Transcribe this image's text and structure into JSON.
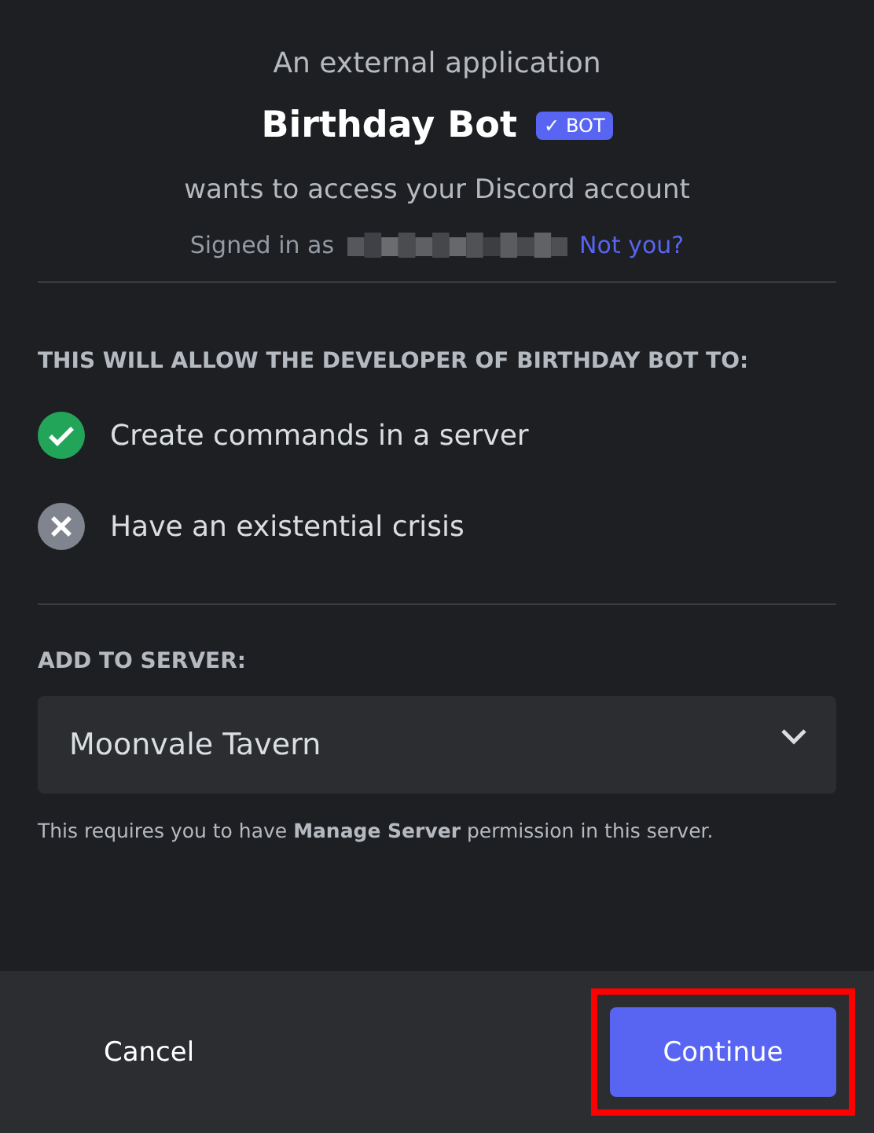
{
  "header": {
    "intro": "An external application",
    "app_name": "Birthday Bot",
    "badge": {
      "check": "✓",
      "label": "BOT"
    },
    "request": "wants to access your Discord account",
    "signed_in_label": "Signed in as",
    "username_redacted": true,
    "switch_link": "Not you?"
  },
  "permissions": {
    "heading": "THIS WILL ALLOW THE DEVELOPER OF BIRTHDAY BOT TO:",
    "items": [
      {
        "label": "Create commands in a server",
        "granted": true
      },
      {
        "label": "Have an existential crisis",
        "granted": false
      }
    ]
  },
  "server": {
    "heading": "ADD TO SERVER:",
    "value": "Moonvale Tavern",
    "note": "This requires you to have **Manage Server** permission in this server."
  },
  "footer": {
    "cancel": "Cancel",
    "continue": "Continue",
    "continue_highlighted": true
  }
}
